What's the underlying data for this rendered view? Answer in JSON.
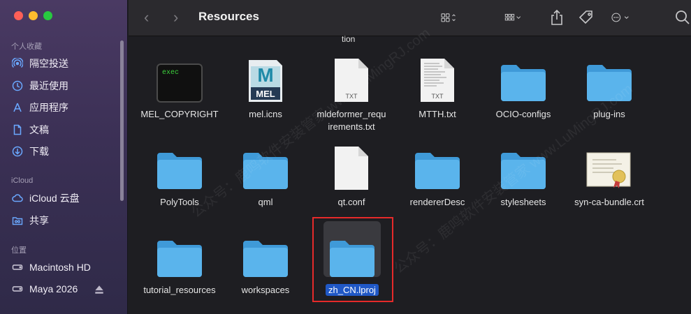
{
  "window": {
    "title": "Resources",
    "nav_back": "‹",
    "nav_forward": "›"
  },
  "sidebar": {
    "sections": [
      {
        "title": "个人收藏",
        "items": [
          {
            "label": "隔空投送",
            "icon": "airdrop-icon"
          },
          {
            "label": "最近使用",
            "icon": "clock-icon"
          },
          {
            "label": "应用程序",
            "icon": "applications-icon"
          },
          {
            "label": "文稿",
            "icon": "document-icon"
          },
          {
            "label": "下载",
            "icon": "download-icon"
          }
        ]
      },
      {
        "title": "iCloud",
        "items": [
          {
            "label": "iCloud 云盘",
            "icon": "cloud-icon"
          },
          {
            "label": "共享",
            "icon": "shared-folder-icon"
          }
        ]
      },
      {
        "title": "位置",
        "items": [
          {
            "label": "Macintosh HD",
            "icon": "disk-icon"
          },
          {
            "label": "Maya 2026",
            "icon": "disk-icon"
          }
        ]
      }
    ]
  },
  "content": {
    "partial_label": "tion",
    "items": [
      {
        "label": "MEL_COPYRIGHT",
        "kind": "exec"
      },
      {
        "label": "mel.icns",
        "kind": "mel"
      },
      {
        "label": "mldeformer_requirements.txt",
        "line1": "mldeformer_requ",
        "line2": "irements.txt",
        "kind": "txt",
        "badge": "TXT"
      },
      {
        "label": "MTTH.txt",
        "kind": "txt-lines",
        "badge": "TXT"
      },
      {
        "label": "OCIO-configs",
        "kind": "folder"
      },
      {
        "label": "plug-ins",
        "kind": "folder"
      },
      {
        "label": "PolyTools",
        "kind": "folder"
      },
      {
        "label": "qml",
        "kind": "folder"
      },
      {
        "label": "qt.conf",
        "kind": "file"
      },
      {
        "label": "rendererDesc",
        "kind": "folder"
      },
      {
        "label": "stylesheets",
        "kind": "folder"
      },
      {
        "label": "syn-ca-bundle.crt",
        "kind": "cert"
      },
      {
        "label": "tutorial_resources",
        "kind": "folder"
      },
      {
        "label": "workspaces",
        "kind": "folder"
      },
      {
        "label": "zh_CN.lproj",
        "kind": "folder",
        "selected": true
      }
    ],
    "exec_text": "exec",
    "mel_big": "M",
    "mel_small": "MEL"
  },
  "watermark": "公众号：鹿鸣软件安装管家 www.LuMingRJ.com",
  "colors": {
    "folder": "#5ab4ec",
    "folder_dark": "#3f9ad8",
    "selection": "#2058c6",
    "highlight": "#e62a2a"
  }
}
